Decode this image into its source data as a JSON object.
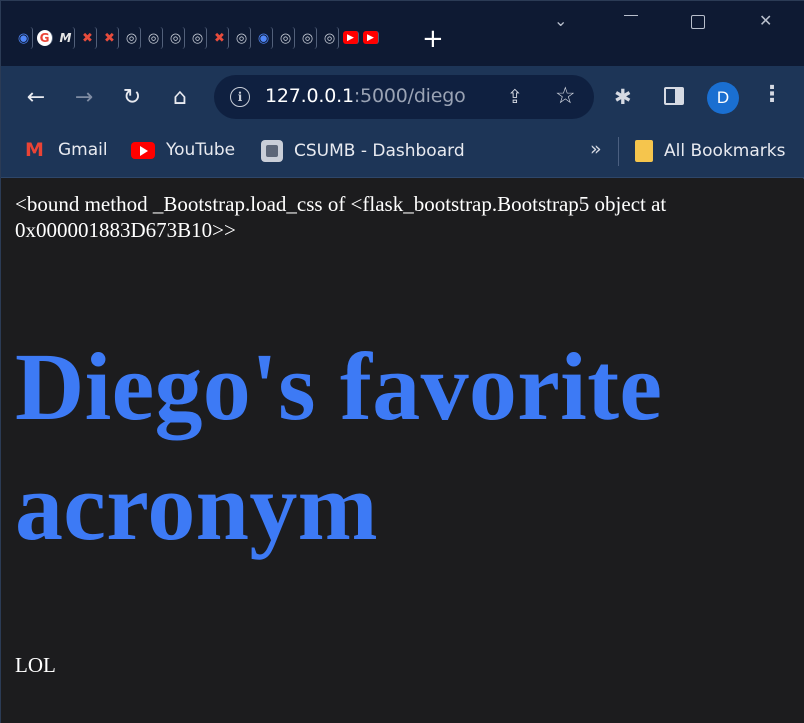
{
  "browser": {
    "tab_icons": [
      "copilot-icon",
      "google-icon",
      "medium-icon",
      "red-tab-icon",
      "red-tab-icon",
      "grey-tab-icon",
      "grey-tab-icon",
      "grey-tab-icon",
      "grey-tab-icon",
      "red-tab-icon",
      "grey-tab-icon",
      "copilot-icon",
      "grey-tab-icon",
      "grey-tab-icon",
      "grey-tab-icon",
      "youtube-icon",
      "youtube-icon"
    ],
    "new_tab_label": "+",
    "address": {
      "host": "127.0.0.1",
      "path": ":5000/diego"
    },
    "avatar_initial": "D",
    "accent_color": "#1a6fd1"
  },
  "bookmarks": {
    "items": [
      {
        "label": "Gmail",
        "icon": "gmail-icon"
      },
      {
        "label": "YouTube",
        "icon": "youtube-icon"
      },
      {
        "label": "CSUMB - Dashboard",
        "icon": "csumb-icon"
      }
    ],
    "overflow_label": "»",
    "all_bookmarks_label": "All Bookmarks"
  },
  "page": {
    "bound_text": "<bound method _Bootstrap.load_css of <flask_bootstrap.Bootstrap5 object at 0x000001883D673B10>>",
    "heading": "Diego's favorite acronym",
    "body_text": "LOL",
    "heading_color": "#3d7af5",
    "background_color": "#1c1c1e"
  }
}
